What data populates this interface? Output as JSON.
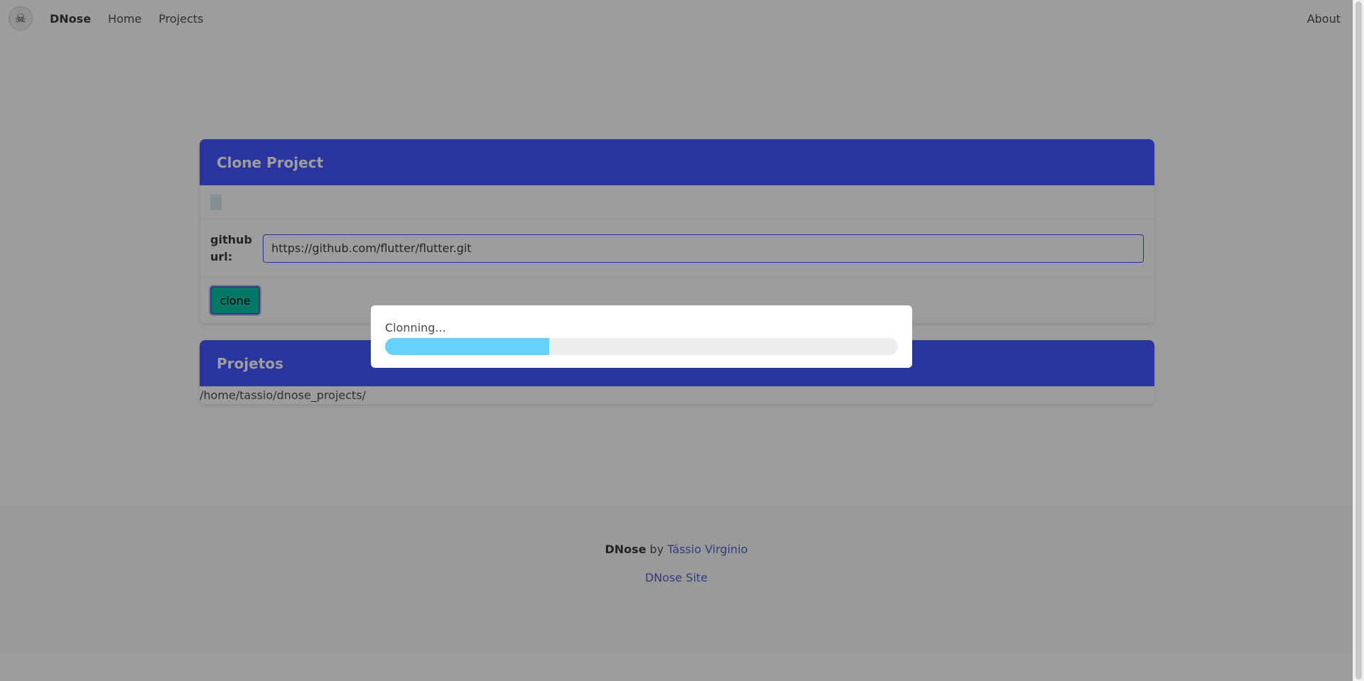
{
  "navbar": {
    "logo_glyph": "☠",
    "brand": "DNose",
    "links": [
      "Home",
      "Projects"
    ],
    "right_link": "About"
  },
  "clone_card": {
    "title": "Clone Project",
    "url_label_line1": "github",
    "url_label_line2": "url:",
    "url_value": "https://github.com/flutter/flutter.git",
    "button_label": "clone"
  },
  "projects_card": {
    "title": "Projetos",
    "path": "/home/tassio/dnose_projects/"
  },
  "footer": {
    "brand": "DNose",
    "by_text": "by",
    "author": "Tássio Virgínio",
    "site_link": "DNose Site"
  },
  "modal": {
    "text": "Clonning...",
    "progress_fraction": 0.32
  },
  "colors": {
    "header_blue": "#3f51ff",
    "button_teal": "#00c4a7",
    "progress_blue": "#66d1ff",
    "link_blue": "#485fc7"
  }
}
